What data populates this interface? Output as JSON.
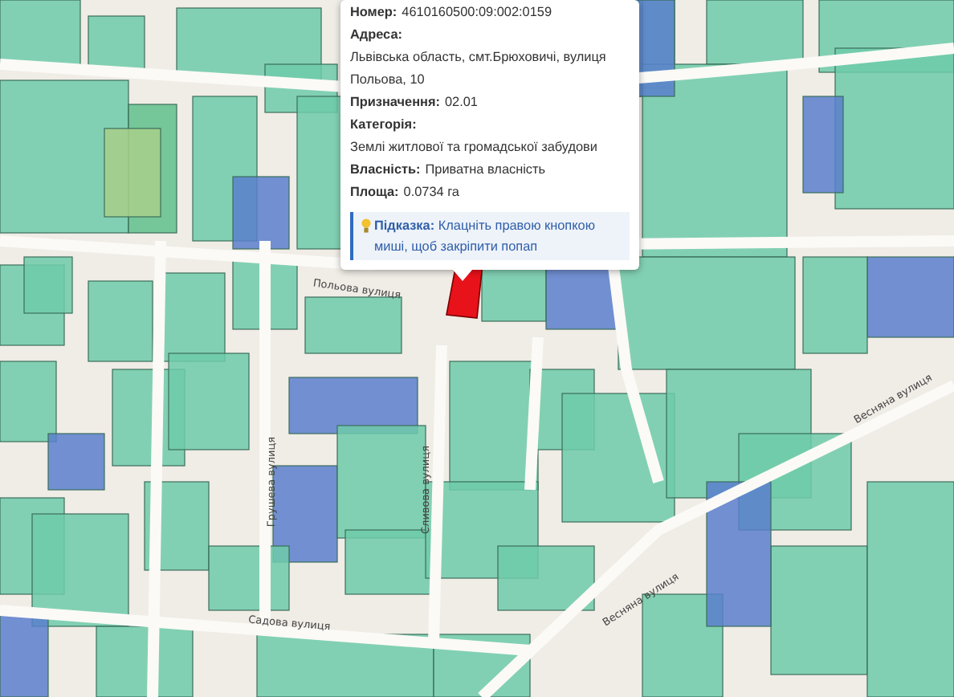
{
  "popup": {
    "fields": [
      {
        "label": "Номер:",
        "value": "4610160500:09:002:0159"
      },
      {
        "label": "Адреса:",
        "value": "Львівська область, смт.Брюховичі, вулиця Польова, 10"
      },
      {
        "label": "Призначення:",
        "value": "02.01"
      },
      {
        "label": "Категорія:",
        "value": "Землі житлової та громадської забудови"
      },
      {
        "label": "Власність:",
        "value": "Приватна власність"
      },
      {
        "label": "Площа:",
        "value": "0.0734 га"
      }
    ],
    "hint": {
      "label": "Підказка:",
      "text": "Клацніть правою кнопкою миші, щоб закріпити попап"
    }
  },
  "street_labels": [
    {
      "text": "Польова вулиця",
      "kind": "rotated"
    },
    {
      "text": "Грушева вулиця",
      "kind": "vertical"
    },
    {
      "text": "Сливова вулиця",
      "kind": "vertical"
    },
    {
      "text": "Садова вулиця",
      "kind": "flat"
    },
    {
      "text": "Весняна вулиця",
      "kind": "diagonal"
    },
    {
      "text": "Весняна вулиця",
      "kind": "diagonal"
    }
  ]
}
